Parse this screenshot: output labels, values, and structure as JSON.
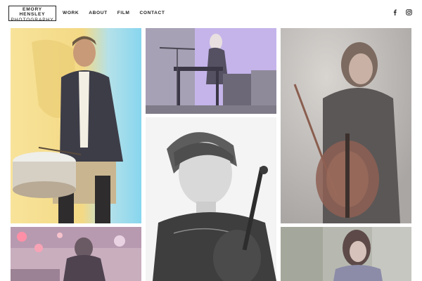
{
  "brand": {
    "line1": "EMORY HENSLEY",
    "line2": "PHOTOGRAPHY"
  },
  "nav": {
    "items": [
      "WORK",
      "ABOUT",
      "FILM",
      "CONTACT"
    ]
  },
  "social": [
    {
      "icon": "facebook-icon"
    },
    {
      "icon": "instagram-icon"
    }
  ],
  "gallery": [
    {
      "subject": "drummer-portrait",
      "palette": {
        "bg1": "#f7d77c",
        "bg2": "#8ad7ee"
      }
    },
    {
      "subject": "stage-keyboard-performance",
      "palette": {
        "bg": "#c8b8ec"
      }
    },
    {
      "subject": "cellist-portrait",
      "palette": {
        "bg": "#b9b6b4"
      }
    },
    {
      "subject": "violinist-portrait",
      "palette": {
        "bg": "#f4f4f4"
      }
    },
    {
      "subject": "concert-stage-lights",
      "palette": {
        "bg": "#d4b7c8"
      }
    },
    {
      "subject": "woman-outdoors-portrait",
      "palette": {
        "bg": "#b4b6ad"
      }
    }
  ]
}
